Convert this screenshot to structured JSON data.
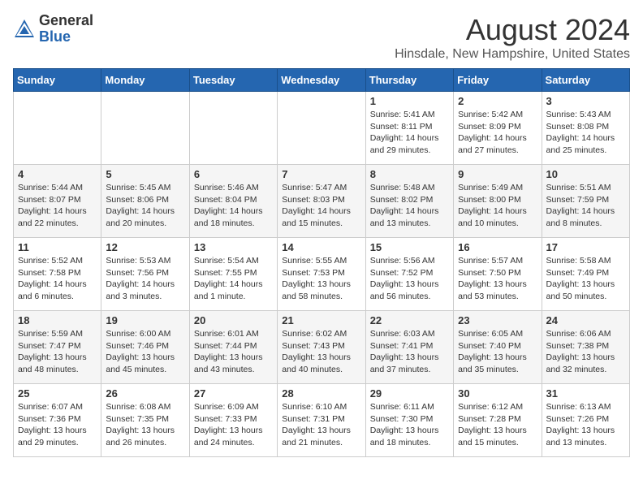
{
  "header": {
    "logo_general": "General",
    "logo_blue": "Blue",
    "main_title": "August 2024",
    "subtitle": "Hinsdale, New Hampshire, United States"
  },
  "columns": [
    "Sunday",
    "Monday",
    "Tuesday",
    "Wednesday",
    "Thursday",
    "Friday",
    "Saturday"
  ],
  "weeks": [
    {
      "days": [
        {
          "num": "",
          "info": ""
        },
        {
          "num": "",
          "info": ""
        },
        {
          "num": "",
          "info": ""
        },
        {
          "num": "",
          "info": ""
        },
        {
          "num": "1",
          "info": "Sunrise: 5:41 AM\nSunset: 8:11 PM\nDaylight: 14 hours\nand 29 minutes."
        },
        {
          "num": "2",
          "info": "Sunrise: 5:42 AM\nSunset: 8:09 PM\nDaylight: 14 hours\nand 27 minutes."
        },
        {
          "num": "3",
          "info": "Sunrise: 5:43 AM\nSunset: 8:08 PM\nDaylight: 14 hours\nand 25 minutes."
        }
      ]
    },
    {
      "days": [
        {
          "num": "4",
          "info": "Sunrise: 5:44 AM\nSunset: 8:07 PM\nDaylight: 14 hours\nand 22 minutes."
        },
        {
          "num": "5",
          "info": "Sunrise: 5:45 AM\nSunset: 8:06 PM\nDaylight: 14 hours\nand 20 minutes."
        },
        {
          "num": "6",
          "info": "Sunrise: 5:46 AM\nSunset: 8:04 PM\nDaylight: 14 hours\nand 18 minutes."
        },
        {
          "num": "7",
          "info": "Sunrise: 5:47 AM\nSunset: 8:03 PM\nDaylight: 14 hours\nand 15 minutes."
        },
        {
          "num": "8",
          "info": "Sunrise: 5:48 AM\nSunset: 8:02 PM\nDaylight: 14 hours\nand 13 minutes."
        },
        {
          "num": "9",
          "info": "Sunrise: 5:49 AM\nSunset: 8:00 PM\nDaylight: 14 hours\nand 10 minutes."
        },
        {
          "num": "10",
          "info": "Sunrise: 5:51 AM\nSunset: 7:59 PM\nDaylight: 14 hours\nand 8 minutes."
        }
      ]
    },
    {
      "days": [
        {
          "num": "11",
          "info": "Sunrise: 5:52 AM\nSunset: 7:58 PM\nDaylight: 14 hours\nand 6 minutes."
        },
        {
          "num": "12",
          "info": "Sunrise: 5:53 AM\nSunset: 7:56 PM\nDaylight: 14 hours\nand 3 minutes."
        },
        {
          "num": "13",
          "info": "Sunrise: 5:54 AM\nSunset: 7:55 PM\nDaylight: 14 hours\nand 1 minute."
        },
        {
          "num": "14",
          "info": "Sunrise: 5:55 AM\nSunset: 7:53 PM\nDaylight: 13 hours\nand 58 minutes."
        },
        {
          "num": "15",
          "info": "Sunrise: 5:56 AM\nSunset: 7:52 PM\nDaylight: 13 hours\nand 56 minutes."
        },
        {
          "num": "16",
          "info": "Sunrise: 5:57 AM\nSunset: 7:50 PM\nDaylight: 13 hours\nand 53 minutes."
        },
        {
          "num": "17",
          "info": "Sunrise: 5:58 AM\nSunset: 7:49 PM\nDaylight: 13 hours\nand 50 minutes."
        }
      ]
    },
    {
      "days": [
        {
          "num": "18",
          "info": "Sunrise: 5:59 AM\nSunset: 7:47 PM\nDaylight: 13 hours\nand 48 minutes."
        },
        {
          "num": "19",
          "info": "Sunrise: 6:00 AM\nSunset: 7:46 PM\nDaylight: 13 hours\nand 45 minutes."
        },
        {
          "num": "20",
          "info": "Sunrise: 6:01 AM\nSunset: 7:44 PM\nDaylight: 13 hours\nand 43 minutes."
        },
        {
          "num": "21",
          "info": "Sunrise: 6:02 AM\nSunset: 7:43 PM\nDaylight: 13 hours\nand 40 minutes."
        },
        {
          "num": "22",
          "info": "Sunrise: 6:03 AM\nSunset: 7:41 PM\nDaylight: 13 hours\nand 37 minutes."
        },
        {
          "num": "23",
          "info": "Sunrise: 6:05 AM\nSunset: 7:40 PM\nDaylight: 13 hours\nand 35 minutes."
        },
        {
          "num": "24",
          "info": "Sunrise: 6:06 AM\nSunset: 7:38 PM\nDaylight: 13 hours\nand 32 minutes."
        }
      ]
    },
    {
      "days": [
        {
          "num": "25",
          "info": "Sunrise: 6:07 AM\nSunset: 7:36 PM\nDaylight: 13 hours\nand 29 minutes."
        },
        {
          "num": "26",
          "info": "Sunrise: 6:08 AM\nSunset: 7:35 PM\nDaylight: 13 hours\nand 26 minutes."
        },
        {
          "num": "27",
          "info": "Sunrise: 6:09 AM\nSunset: 7:33 PM\nDaylight: 13 hours\nand 24 minutes."
        },
        {
          "num": "28",
          "info": "Sunrise: 6:10 AM\nSunset: 7:31 PM\nDaylight: 13 hours\nand 21 minutes."
        },
        {
          "num": "29",
          "info": "Sunrise: 6:11 AM\nSunset: 7:30 PM\nDaylight: 13 hours\nand 18 minutes."
        },
        {
          "num": "30",
          "info": "Sunrise: 6:12 AM\nSunset: 7:28 PM\nDaylight: 13 hours\nand 15 minutes."
        },
        {
          "num": "31",
          "info": "Sunrise: 6:13 AM\nSunset: 7:26 PM\nDaylight: 13 hours\nand 13 minutes."
        }
      ]
    }
  ]
}
